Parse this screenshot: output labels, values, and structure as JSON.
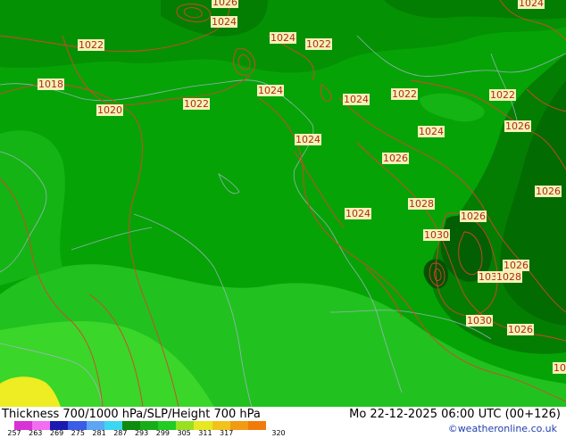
{
  "map": {
    "isobar_labels": [
      {
        "id": "1026-top",
        "text": "1026"
      },
      {
        "id": "1024-top-right",
        "text": "1024"
      },
      {
        "id": "1024-north-a",
        "text": "1024"
      },
      {
        "id": "1022-north-west",
        "text": "1022"
      },
      {
        "id": "1024-north-b",
        "text": "1024"
      },
      {
        "id": "1022-north-c",
        "text": "1022"
      },
      {
        "id": "1018-west",
        "text": "1018"
      },
      {
        "id": "1024-center-north",
        "text": "1024"
      },
      {
        "id": "1020-west",
        "text": "1020"
      },
      {
        "id": "1022-center",
        "text": "1022"
      },
      {
        "id": "1024-center",
        "text": "1024"
      },
      {
        "id": "1022-east-a",
        "text": "1022"
      },
      {
        "id": "1022-east-b",
        "text": "1022"
      },
      {
        "id": "1024-center-b",
        "text": "1024"
      },
      {
        "id": "1024-east",
        "text": "1024"
      },
      {
        "id": "1026-east",
        "text": "1026"
      },
      {
        "id": "1026-center-east",
        "text": "1026"
      },
      {
        "id": "1026-far-east",
        "text": "1026"
      },
      {
        "id": "1028-east",
        "text": "1028"
      },
      {
        "id": "1024-south-center",
        "text": "1024"
      },
      {
        "id": "1026-south-east",
        "text": "1026"
      },
      {
        "id": "1030-south-east-a",
        "text": "1030"
      },
      {
        "id": "1026-south-east-b",
        "text": "1026"
      },
      {
        "id": "1030-south-east-b",
        "text": "1030"
      },
      {
        "id": "1028-south-east",
        "text": "1028"
      },
      {
        "id": "1030-south-east-c",
        "text": "1030"
      },
      {
        "id": "1026-south-east-c",
        "text": "1026"
      },
      {
        "id": "edge-right",
        "text": "10"
      }
    ]
  },
  "footer": {
    "title": "Thickness 700/1000 hPa/SLP/Height 700 hPa",
    "datetime": "Mo 22-12-2025 06:00 UTC (00+126)",
    "credit": "©weatheronline.co.uk",
    "scale_colors": [
      "#d633d6",
      "#f26df2",
      "#1a1ab0",
      "#3a5ce8",
      "#5ba6f5",
      "#3dd6f0",
      "#0d8c0d",
      "#18ad18",
      "#22cc22",
      "#98e022",
      "#e8e822",
      "#f2c21a",
      "#f29a12",
      "#f27a0a"
    ],
    "scale_ticks": [
      "257",
      "263",
      "269",
      "275",
      "281",
      "287",
      "293",
      "299",
      "305",
      "311",
      "317",
      "320"
    ]
  }
}
